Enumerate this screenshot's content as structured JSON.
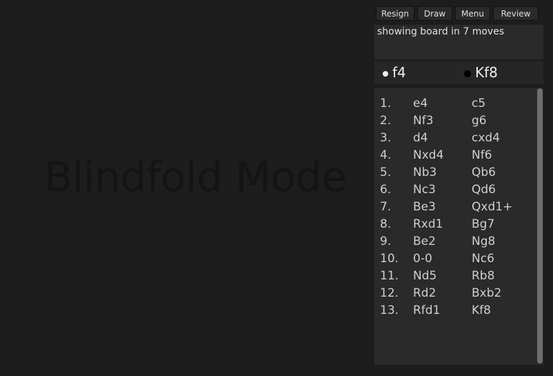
{
  "board": {
    "mode_title": "Blindfold Mode"
  },
  "toolbar": {
    "resign": "Resign",
    "draw": "Draw",
    "menu": "Menu",
    "review": "Review"
  },
  "status": {
    "text": "showing board in 7 moves"
  },
  "last_moves": {
    "white": "f4",
    "black": "Kf8"
  },
  "moves": [
    {
      "num": "1.",
      "white": "e4",
      "black": "c5"
    },
    {
      "num": "2.",
      "white": "Nf3",
      "black": "g6"
    },
    {
      "num": "3.",
      "white": "d4",
      "black": "cxd4"
    },
    {
      "num": "4.",
      "white": "Nxd4",
      "black": "Nf6"
    },
    {
      "num": "5.",
      "white": "Nb3",
      "black": "Qb6"
    },
    {
      "num": "6.",
      "white": "Nc3",
      "black": "Qd6"
    },
    {
      "num": "7.",
      "white": "Be3",
      "black": "Qxd1+"
    },
    {
      "num": "8.",
      "white": "Rxd1",
      "black": "Bg7"
    },
    {
      "num": "9.",
      "white": "Be2",
      "black": "Ng8"
    },
    {
      "num": "10.",
      "white": "0-0",
      "black": "Nc6"
    },
    {
      "num": "11.",
      "white": "Nd5",
      "black": "Rb8"
    },
    {
      "num": "12.",
      "white": "Rd2",
      "black": "Bxb2"
    },
    {
      "num": "13.",
      "white": "Rfd1",
      "black": "Kf8"
    }
  ]
}
